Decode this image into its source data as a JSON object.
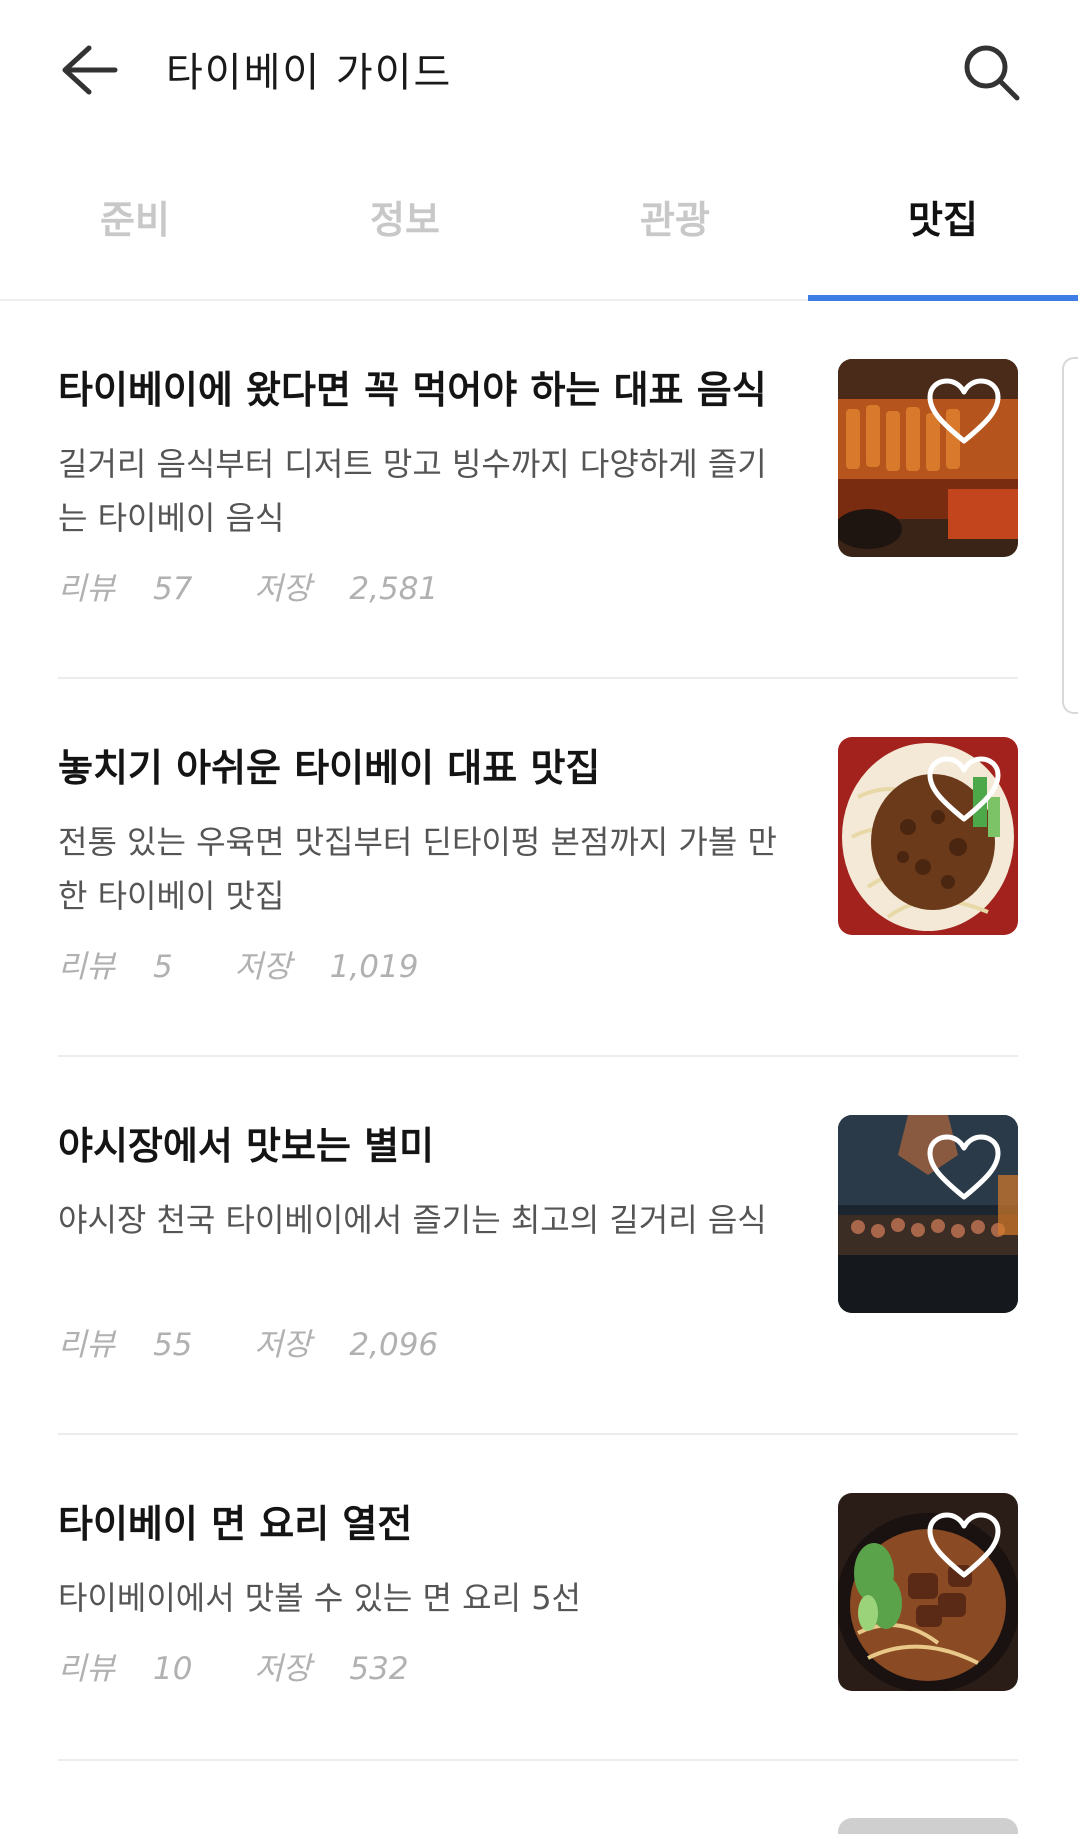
{
  "header": {
    "title": "타이베이 가이드",
    "back_icon": "arrow-left-icon",
    "search_icon": "search-icon"
  },
  "tabs": [
    {
      "label": "준비",
      "active": false
    },
    {
      "label": "정보",
      "active": false
    },
    {
      "label": "관광",
      "active": false
    },
    {
      "label": "맛집",
      "active": true
    }
  ],
  "colors": {
    "accent": "#3d7ee6",
    "inactive_tab": "#c8c8c8",
    "meta_text": "#b1b1b1"
  },
  "meta_labels": {
    "reviews": "리뷰",
    "saves": "저장"
  },
  "articles": [
    {
      "title": "타이베이에 왔다면 꼭 먹어야 하는 대표 음식",
      "description": "길거리 음식부터 디저트 망고 빙수까지 다양하게 즐기는 타이베이 음식",
      "reviews": "57",
      "saves": "2,581",
      "thumbnail": "skewers-street-food-image"
    },
    {
      "title": "놓치기 아쉬운 타이베이 대표 맛집",
      "description": "전통 있는 우육면 맛집부터 딘타이펑 본점까지 가볼 만한 타이베이 맛집",
      "reviews": "5",
      "saves": "1,019",
      "thumbnail": "noodles-meat-sauce-image"
    },
    {
      "title": "야시장에서 맛보는 별미",
      "description": "야시장 천국 타이베이에서 즐기는 최고의 길거리 음식",
      "reviews": "55",
      "saves": "2,096",
      "thumbnail": "night-market-grill-image"
    },
    {
      "title": "타이베이 면 요리 열전",
      "description": "타이베이에서 맛볼 수 있는 면 요리 5선",
      "reviews": "10",
      "saves": "532",
      "thumbnail": "beef-noodle-soup-image"
    }
  ]
}
